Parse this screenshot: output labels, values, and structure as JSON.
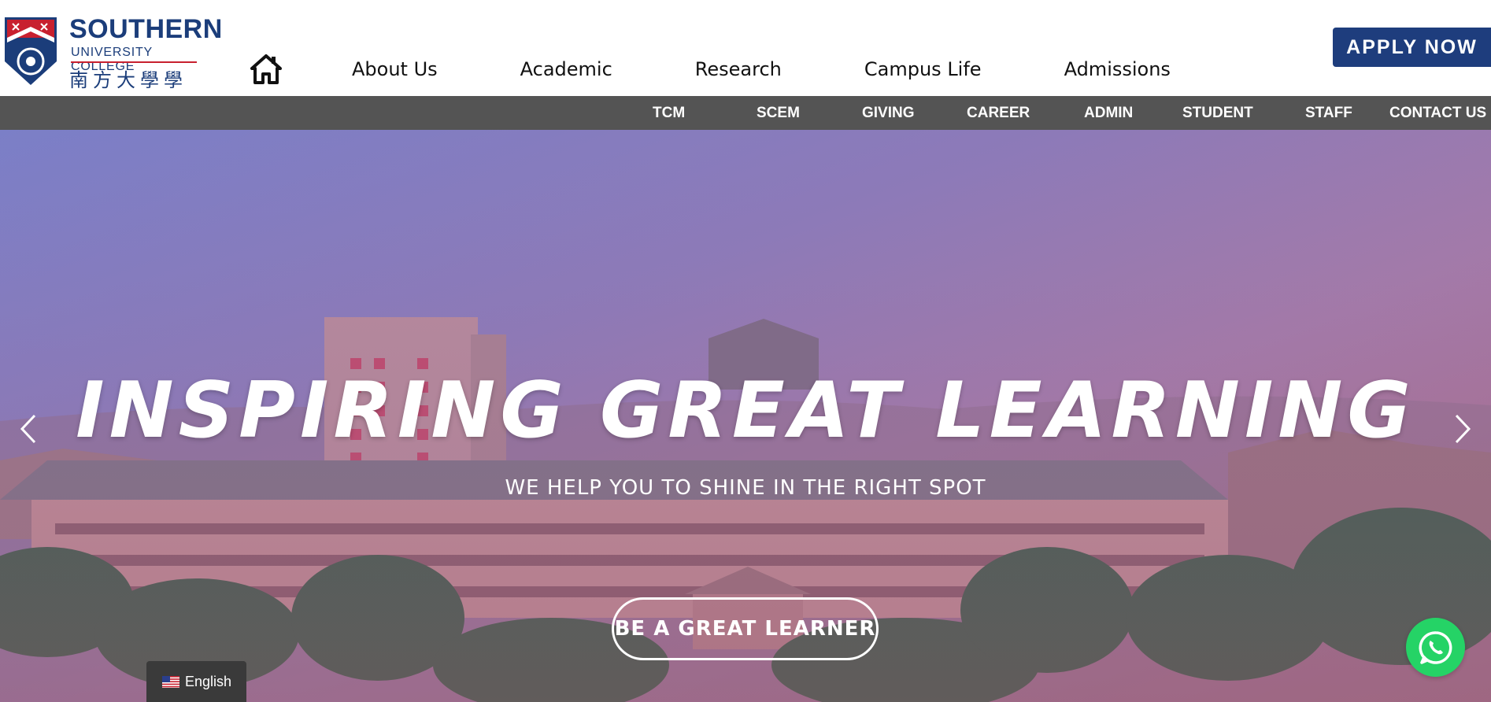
{
  "brand": {
    "name": "SOUTHERN",
    "subtitle": "UNIVERSITY COLLEGE",
    "chinese": "南方大學學院"
  },
  "header": {
    "nav": [
      "About Us",
      "Academic",
      "Research",
      "Campus Life",
      "Admissions"
    ],
    "apply_label": "APPLY NOW"
  },
  "subnav": {
    "items": [
      "TCM",
      "SCEM",
      "GIVING",
      "CAREER",
      "ADMIN",
      "STUDENT",
      "STAFF",
      "CONTACT US"
    ]
  },
  "hero": {
    "title": "INSPIRING GREAT LEARNING",
    "subtitle": "WE HELP YOU TO SHINE IN THE RIGHT SPOT",
    "cta": "BE A GREAT LEARNER"
  },
  "language": {
    "selected": "English"
  },
  "colors": {
    "brand_blue": "#1e3d7d",
    "subnav_bg": "#545454",
    "whatsapp_green": "#25d366"
  },
  "icons": [
    "home-icon",
    "chevron-left-icon",
    "chevron-right-icon",
    "whatsapp-icon",
    "us-flag-icon"
  ]
}
